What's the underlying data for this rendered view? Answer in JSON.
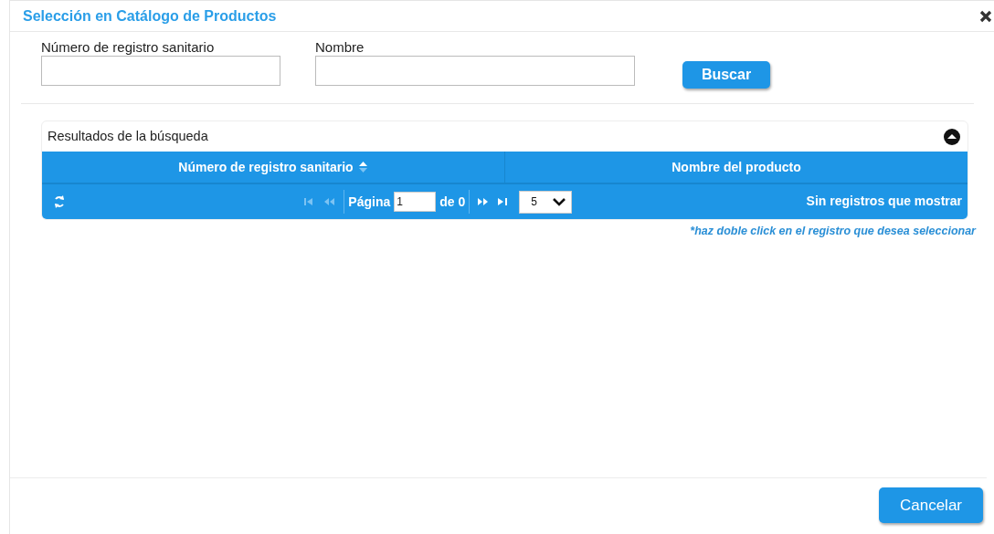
{
  "dialog": {
    "title": "Selección en Catálogo de Productos"
  },
  "search_form": {
    "fields": [
      {
        "label": "Número de registro sanitario"
      },
      {
        "label": "Nombre"
      }
    ],
    "button": "Buscar"
  },
  "results": {
    "title": "Resultados de la búsqueda",
    "collapsed": false,
    "columns": [
      {
        "label": "Número de registro sanitario",
        "sorted": true
      },
      {
        "label": "Nombre del producto",
        "sorted": false
      }
    ],
    "pager": {
      "first_disabled": true,
      "prev_disabled": true,
      "page_label": "Página",
      "page": "1",
      "of_label": "de 0",
      "next_disabled": false,
      "last_disabled": false,
      "page_size": "5",
      "status": "Sin registros que mostrar"
    },
    "hint": "*haz doble click en el registro que desea seleccionar"
  },
  "footer": {
    "button": "Cancelar"
  }
}
